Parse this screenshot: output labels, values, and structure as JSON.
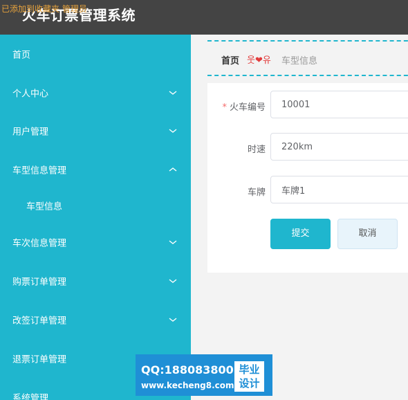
{
  "header": {
    "title": "火车订票管理系统",
    "notice": "已添加到收藏夹 管理员"
  },
  "sidebar": {
    "items": [
      {
        "label": "首页"
      },
      {
        "label": "个人中心",
        "chevron": "down"
      },
      {
        "label": "用户管理",
        "chevron": "down"
      },
      {
        "label": "车型信息管理",
        "chevron": "up"
      },
      {
        "label": "车型信息",
        "sub": true
      },
      {
        "label": "车次信息管理",
        "chevron": "down"
      },
      {
        "label": "购票订单管理",
        "chevron": "down"
      },
      {
        "label": "改签订单管理",
        "chevron": "down"
      },
      {
        "label": "退票订单管理"
      },
      {
        "label": "系统管理"
      }
    ]
  },
  "breadcrumb": {
    "home": "首页",
    "separator": "웃❤유",
    "current": "车型信息"
  },
  "form": {
    "fields": [
      {
        "label": "火车编号",
        "required": true,
        "value": "10001"
      },
      {
        "label": "时速",
        "required": false,
        "value": "220km"
      },
      {
        "label": "车牌",
        "required": false,
        "value": "车牌1"
      }
    ],
    "submit_label": "提交",
    "cancel_label": "取消"
  },
  "watermark": {
    "qq": "QQ:188083800",
    "url": "www.kecheng8.com",
    "badge_line1": "毕业",
    "badge_line2": "设计"
  },
  "colors": {
    "sidebar_bg": "#1fb6ce",
    "header_bg": "#444444",
    "accent": "#1fb6ce",
    "watermark_bg": "#1f8fd6"
  },
  "icons": {
    "chevron_down": "chevron-down-icon",
    "chevron_up": "chevron-up-icon"
  }
}
